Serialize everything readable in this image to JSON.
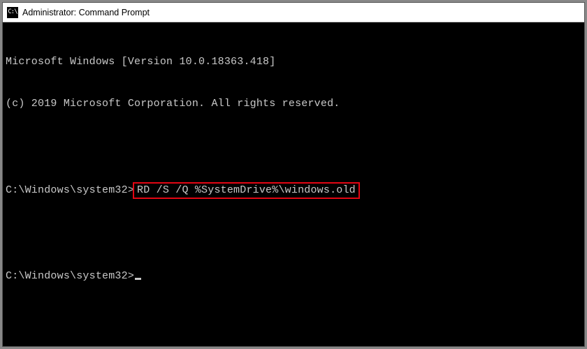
{
  "window": {
    "title": "Administrator: Command Prompt",
    "icon_label": "C:\\"
  },
  "terminal": {
    "version_line": "Microsoft Windows [Version 10.0.18363.418]",
    "copyright_line": "(c) 2019 Microsoft Corporation. All rights reserved.",
    "prompt1": "C:\\Windows\\system32>",
    "command1": "RD /S /Q %SystemDrive%\\windows.old",
    "prompt2": "C:\\Windows\\system32>"
  },
  "highlight": {
    "color": "#e30613"
  }
}
